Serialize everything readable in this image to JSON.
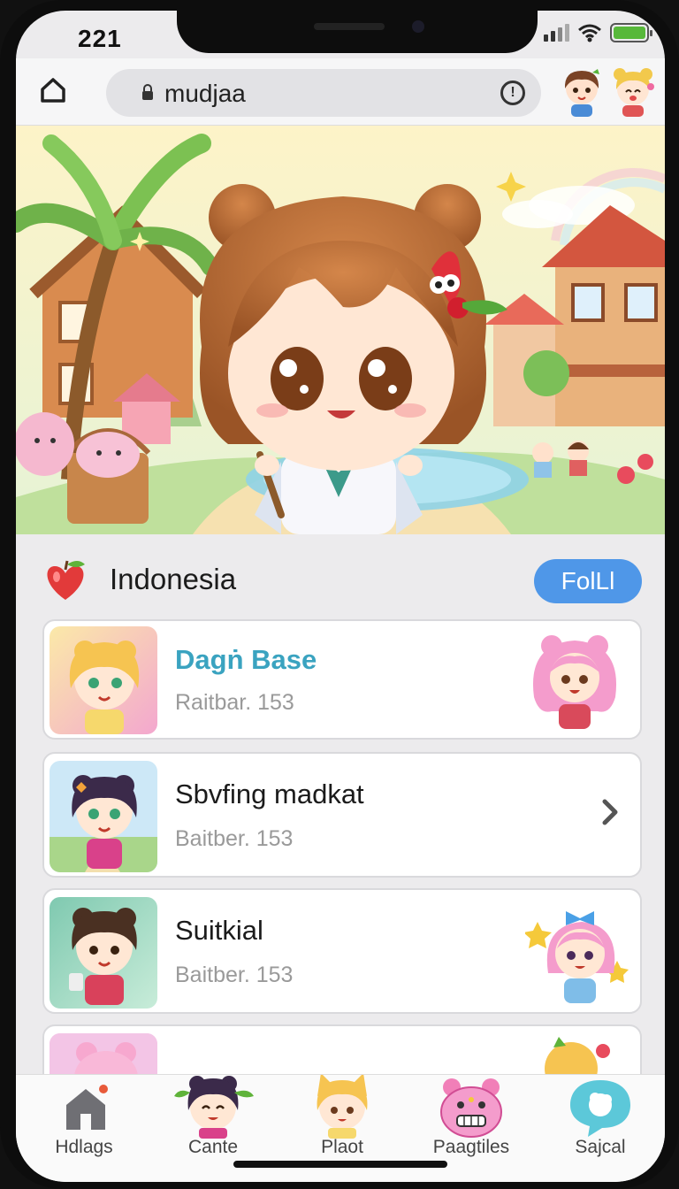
{
  "status": {
    "time": "221",
    "battery_level": 1.0
  },
  "browser": {
    "url": "mudjaa",
    "info_label": "!"
  },
  "section": {
    "title": "Indonesia",
    "follow_label": "FolLl"
  },
  "cards": [
    {
      "title": "Dagṅ Base",
      "subtitle": "Raitbar. 153",
      "accent": true
    },
    {
      "title": "Sbvfing madkat",
      "subtitle": "Baitber. 153"
    },
    {
      "title": "Suitkial",
      "subtitle": "Baitber. 153"
    }
  ],
  "tabs": [
    {
      "label": "Hdlags",
      "icon": "house-icon"
    },
    {
      "label": "Cante",
      "icon": "character-icon"
    },
    {
      "label": "Plaot",
      "icon": "cat-character-icon"
    },
    {
      "label": "Paagtiles",
      "icon": "pink-bear-icon"
    },
    {
      "label": "Sajcal",
      "icon": "chat-bubble-icon"
    }
  ],
  "colors": {
    "accent": "#3aa3c0",
    "follow": "#4f97e8",
    "battery": "#57b83a"
  }
}
